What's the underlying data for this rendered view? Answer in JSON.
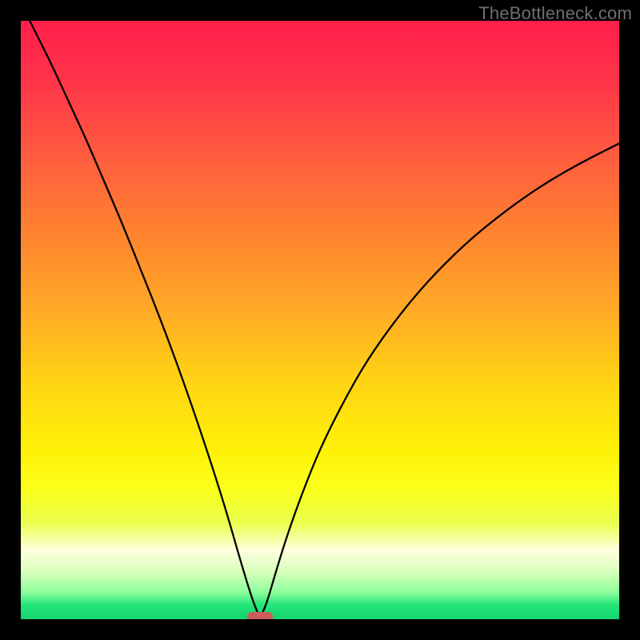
{
  "watermark": {
    "text": "TheBottleneck.com"
  },
  "colors": {
    "frame": "#000000",
    "curve": "#000000",
    "marker": "#cf5b5d",
    "gradient_stops": [
      {
        "offset": 0.0,
        "color": "#ff1f4b"
      },
      {
        "offset": 0.1,
        "color": "#ff3449"
      },
      {
        "offset": 0.22,
        "color": "#ff5a3f"
      },
      {
        "offset": 0.35,
        "color": "#ff8230"
      },
      {
        "offset": 0.48,
        "color": "#ffa826"
      },
      {
        "offset": 0.6,
        "color": "#ffd314"
      },
      {
        "offset": 0.72,
        "color": "#fff207"
      },
      {
        "offset": 0.78,
        "color": "#fbff19"
      },
      {
        "offset": 0.84,
        "color": "#eaff4f"
      },
      {
        "offset": 0.885,
        "color": "#ffffe0"
      },
      {
        "offset": 0.92,
        "color": "#d8ffba"
      },
      {
        "offset": 0.955,
        "color": "#8dff9c"
      },
      {
        "offset": 0.975,
        "color": "#27e57a"
      },
      {
        "offset": 1.0,
        "color": "#11d56d"
      }
    ]
  },
  "chart_data": {
    "type": "line",
    "title": "",
    "xlabel": "",
    "ylabel": "",
    "xlim": [
      0,
      100
    ],
    "ylim": [
      0,
      100
    ],
    "grid": false,
    "series": [
      {
        "name": "bottleneck-curve",
        "x": [
          0,
          2,
          5,
          8,
          11,
          14,
          17,
          20,
          23,
          26,
          29,
          32,
          34.5,
          36.5,
          38,
          39,
          39.7,
          40.3,
          41.2,
          42.5,
          44.5,
          47,
          50,
          54,
          58,
          63,
          68,
          74,
          80,
          87,
          94,
          100
        ],
        "y": [
          103,
          99,
          93,
          86.5,
          80,
          73,
          66,
          58.5,
          51,
          43,
          34.5,
          25.5,
          17.5,
          10.5,
          5.5,
          2.5,
          0.8,
          0.8,
          3,
          7.5,
          14,
          21,
          28.5,
          36.5,
          43.5,
          50.5,
          56.5,
          62.5,
          67.5,
          72.5,
          76.5,
          79.5
        ]
      }
    ],
    "annotations": [
      {
        "name": "min-marker",
        "x": 40,
        "y": 0.4,
        "shape": "pill",
        "color": "#cf5b5d"
      }
    ]
  }
}
